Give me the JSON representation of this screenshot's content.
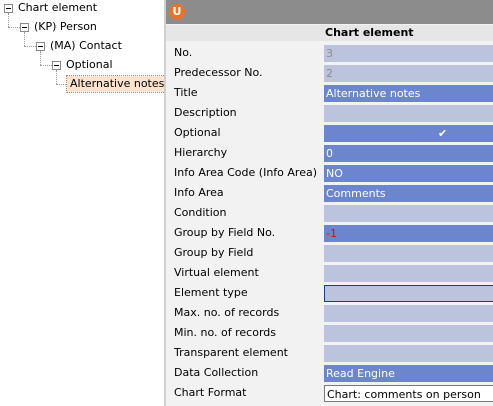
{
  "tree": {
    "nodes": [
      {
        "label": "Chart element"
      },
      {
        "label": "(KP) Person"
      },
      {
        "label": "(MA) Contact"
      },
      {
        "label": "Optional"
      },
      {
        "label": "Alternative notes"
      }
    ]
  },
  "panel": {
    "logo": "U",
    "header": "Chart element",
    "fields": [
      {
        "label": "No.",
        "value": "3"
      },
      {
        "label": "Predecessor No.",
        "value": "2"
      },
      {
        "label": "Title",
        "value": "Alternative notes"
      },
      {
        "label": "Description",
        "value": ""
      },
      {
        "label": "Optional",
        "value": "✔"
      },
      {
        "label": "Hierarchy",
        "value": "0"
      },
      {
        "label": "Info Area Code (Info Area)",
        "value": "NO"
      },
      {
        "label": "Info Area",
        "value": "Comments"
      },
      {
        "label": "Condition",
        "value": ""
      },
      {
        "label": "Group by Field No.",
        "value": "-1"
      },
      {
        "label": "Group by Field",
        "value": ""
      },
      {
        "label": "Virtual element",
        "value": ""
      },
      {
        "label": "Element type",
        "value": ""
      },
      {
        "label": "Max. no. of records",
        "value": ""
      },
      {
        "label": "Min. no. of records",
        "value": ""
      },
      {
        "label": "Transparent element",
        "value": ""
      },
      {
        "label": "Data Collection",
        "value": "Read Engine"
      },
      {
        "label": "Chart Format",
        "value": "Chart: comments on person"
      }
    ]
  },
  "colors": {
    "selected_value": "#6b86cf",
    "empty_value": "#bcc3dd",
    "selected_tree_item": "#fbe3cf",
    "negative_value": "#d01010"
  }
}
